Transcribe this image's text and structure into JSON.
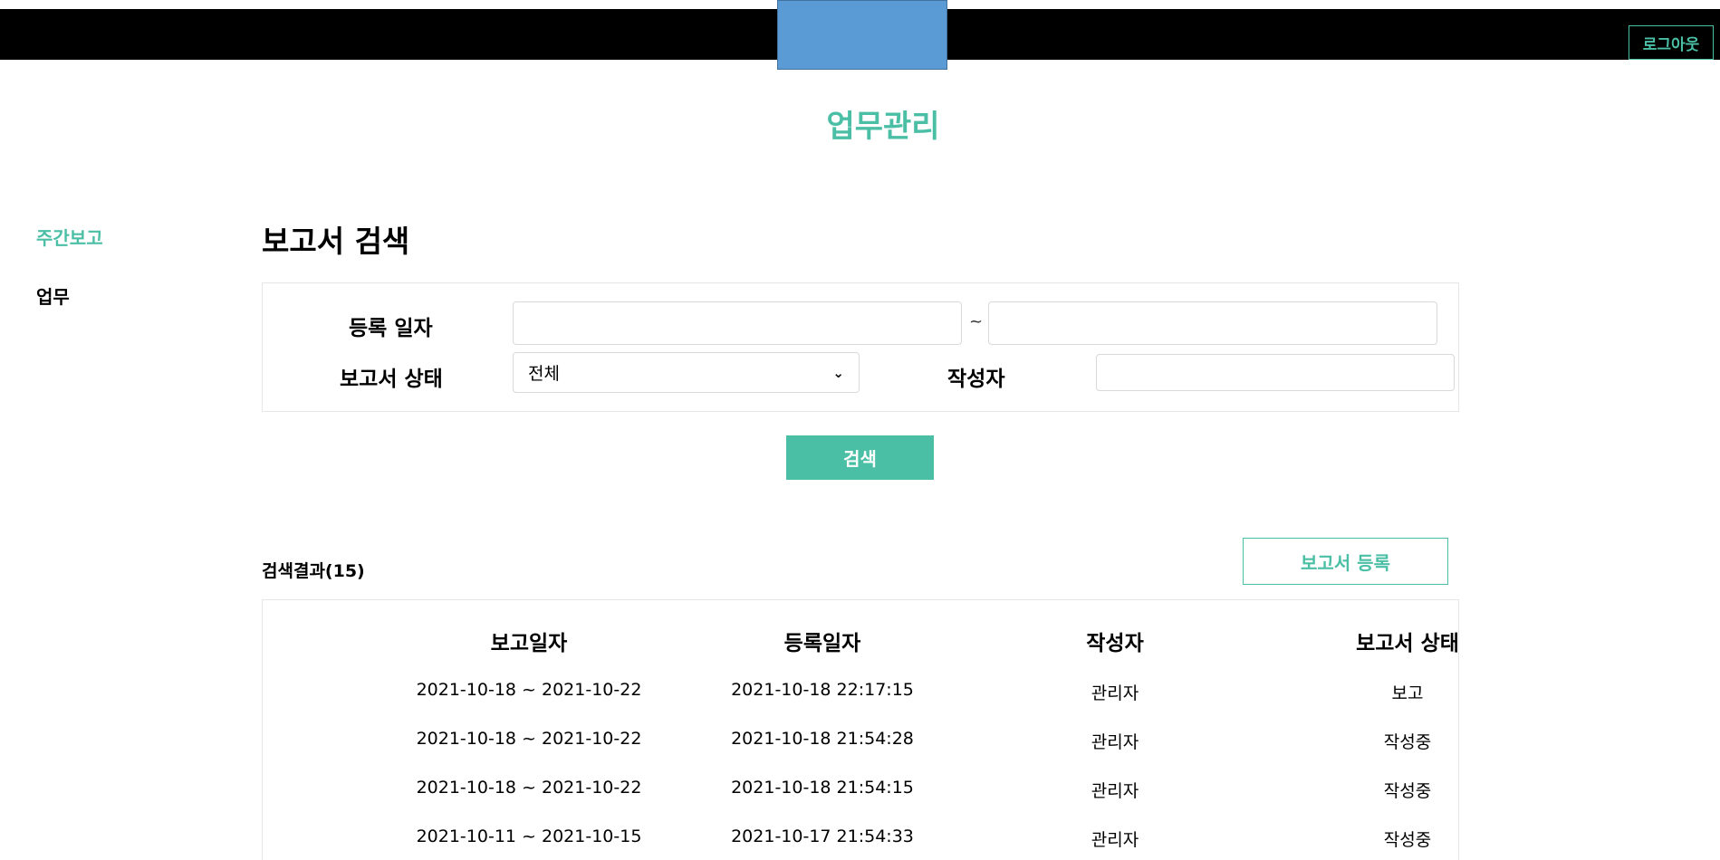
{
  "header": {
    "logout_label": "로그아웃"
  },
  "page_title": "업무관리",
  "sidebar": {
    "items": [
      {
        "label": "주간보고"
      },
      {
        "label": "업무"
      }
    ]
  },
  "search": {
    "title": "보고서 검색",
    "reg_date_label": "등록 일자",
    "date_sep": "~",
    "status_label": "보고서 상태",
    "status_selected": "전체",
    "author_label": "작성자",
    "button_label": "검색"
  },
  "results": {
    "count_label": "검색결과(15)",
    "register_label": "보고서 등록",
    "columns": [
      "보고일자",
      "등록일자",
      "작성자",
      "보고서 상태"
    ],
    "rows": [
      [
        "2021-10-18 ~ 2021-10-22",
        "2021-10-18 22:17:15",
        "관리자",
        "보고"
      ],
      [
        "2021-10-18 ~ 2021-10-22",
        "2021-10-18 21:54:28",
        "관리자",
        "작성중"
      ],
      [
        "2021-10-18 ~ 2021-10-22",
        "2021-10-18 21:54:15",
        "관리자",
        "작성중"
      ],
      [
        "2021-10-11 ~ 2021-10-15",
        "2021-10-17 21:54:33",
        "관리자",
        "작성중"
      ]
    ]
  },
  "colors": {
    "accent": "#4bbfa5",
    "logo_block": "#5b9bd5",
    "topbar": "#000000"
  }
}
